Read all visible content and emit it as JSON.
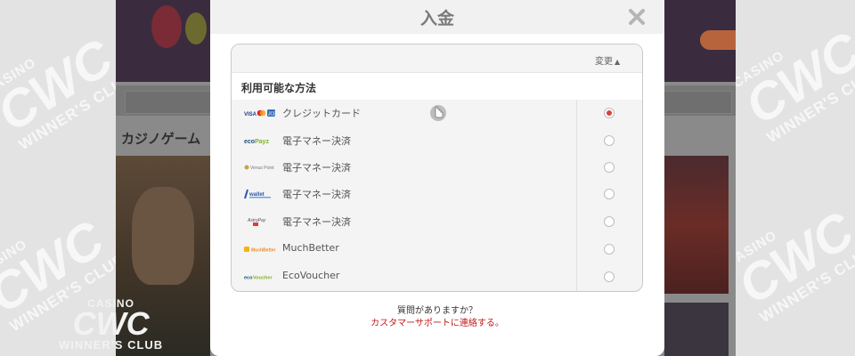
{
  "modal": {
    "title": "入金",
    "change_label": "変更",
    "section_label": "利用可能な方法",
    "methods": [
      {
        "logo": "visa-mastercard-jcb-logo",
        "name": "クレジットカード",
        "selected": true
      },
      {
        "logo": "ecopayz-logo",
        "name": "電子マネー決済",
        "selected": false
      },
      {
        "logo": "venus-point-logo",
        "name": "電子マネー決済",
        "selected": false
      },
      {
        "logo": "iwallet-logo",
        "name": "電子マネー決済",
        "selected": false
      },
      {
        "logo": "astropay-logo",
        "name": "電子マネー決済",
        "selected": false
      },
      {
        "logo": "muchbetter-logo",
        "name": "MuchBetter",
        "selected": false
      },
      {
        "logo": "ecovoucher-logo",
        "name": "EcoVoucher",
        "selected": false
      }
    ],
    "help_question": "質問がありますか？",
    "help_link": "カスタマーサポートに連絡する。"
  },
  "background": {
    "section_title": "カジノゲーム",
    "logo_casino": "CASINO",
    "logo_cwc": "CWC",
    "logo_winners": "WINNER'S CLUB"
  },
  "colors": {
    "accent_red": "#d9433c",
    "link_red": "#c21a1a",
    "panel_bg": "#f4f4f4"
  }
}
